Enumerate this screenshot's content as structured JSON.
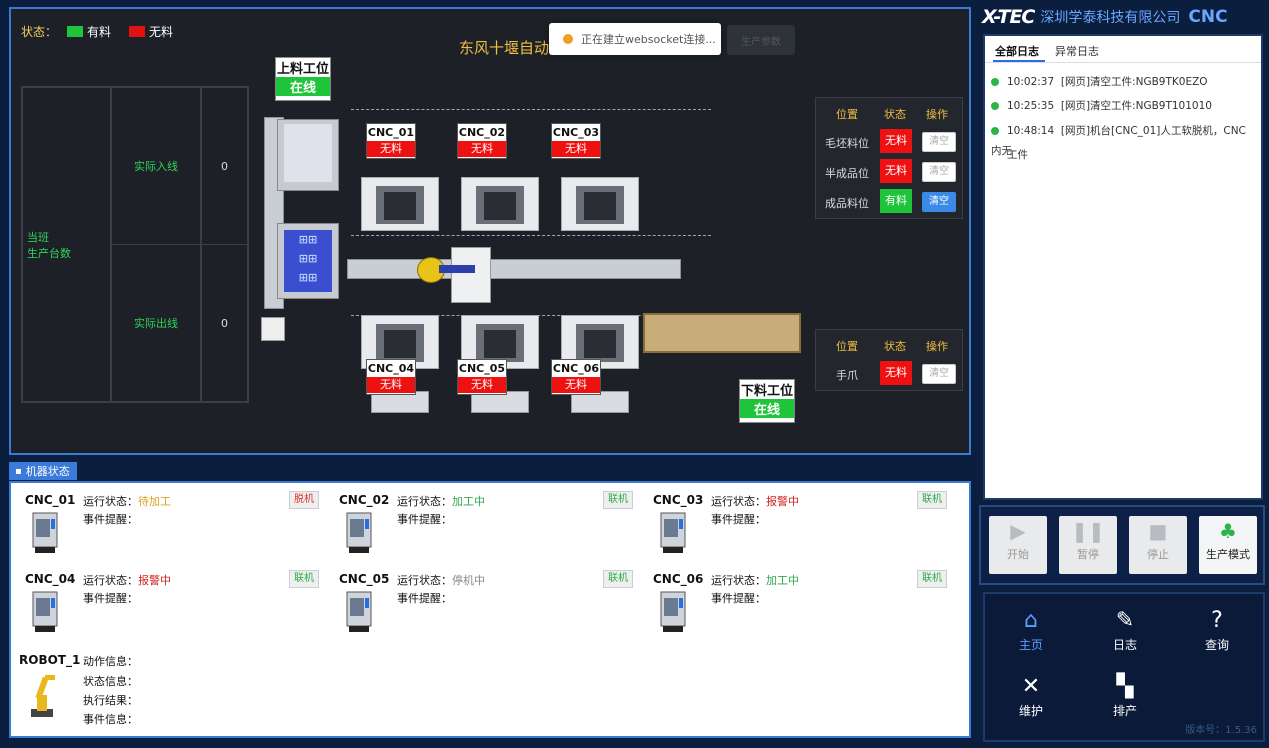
{
  "header": {
    "brand_logo": "X-TEC",
    "company": "深圳学泰科技有限公司",
    "product": "CNC",
    "accent_color": "#3c7ad9"
  },
  "legend": {
    "label": "状态：",
    "has_material": "有料",
    "has_material_color": "#1ec43a",
    "no_material": "无料",
    "no_material_color": "#e11111"
  },
  "line_title": "东风十堰自动",
  "toast": {
    "text": "正在建立websocket连接...",
    "ghost_button": "生产参数"
  },
  "production": {
    "group_label_1": "当班",
    "group_label_2": "生产台数",
    "in_label": "实际入线",
    "in_value": "0",
    "out_label": "实际出线",
    "out_value": "0"
  },
  "stations": {
    "load_title": "上料工位",
    "load_state": "在线",
    "unload_title": "下料工位",
    "unload_state": "在线"
  },
  "cnc_labels": [
    {
      "name": "CNC_01",
      "state": "无料"
    },
    {
      "name": "CNC_02",
      "state": "无料"
    },
    {
      "name": "CNC_03",
      "state": "无料"
    },
    {
      "name": "CNC_04",
      "state": "无料"
    },
    {
      "name": "CNC_05",
      "state": "无料"
    },
    {
      "name": "CNC_06",
      "state": "无料"
    }
  ],
  "material_table": {
    "headers": [
      "位置",
      "状态",
      "操作"
    ],
    "rows": [
      {
        "position": "毛坯料位",
        "state": "无料",
        "action": "清空",
        "active": false
      },
      {
        "position": "半成品位",
        "state": "无料",
        "action": "清空",
        "active": false
      },
      {
        "position": "成品料位",
        "state": "有料",
        "action": "清空",
        "active": true
      }
    ]
  },
  "gripper_table": {
    "headers": [
      "位置",
      "状态",
      "操作"
    ],
    "rows": [
      {
        "position": "手爪",
        "state": "无料",
        "action": "清空"
      }
    ]
  },
  "machine_status": {
    "tab": "机器状态",
    "run_label": "运行状态：",
    "event_label": "事件提醒：",
    "machines": [
      {
        "name": "CNC_01",
        "state": "待加工",
        "state_color": "#e0a020",
        "link": "脱机",
        "link_color": "#e03030"
      },
      {
        "name": "CNC_02",
        "state": "加工中",
        "state_color": "#2fa84a",
        "link": "联机",
        "link_color": "#2fa84a"
      },
      {
        "name": "CNC_03",
        "state": "报警中",
        "state_color": "#d02020",
        "link": "联机",
        "link_color": "#2fa84a"
      },
      {
        "name": "CNC_04",
        "state": "报警中",
        "state_color": "#d02020",
        "link": "联机",
        "link_color": "#2fa84a"
      },
      {
        "name": "CNC_05",
        "state": "停机中",
        "state_color": "#888888",
        "link": "联机",
        "link_color": "#2fa84a"
      },
      {
        "name": "CNC_06",
        "state": "加工中",
        "state_color": "#2fa84a",
        "link": "联机",
        "link_color": "#2fa84a"
      }
    ],
    "robot": {
      "name": "ROBOT_1",
      "action_label": "动作信息：",
      "status_label": "状态信息：",
      "result_label": "执行结果：",
      "event_label": "事件信息："
    }
  },
  "logs": {
    "tabs": [
      "全部日志",
      "异常日志"
    ],
    "entries": [
      {
        "time": "10:02:37",
        "text": "[网页]清空工件:NGB9TK0EZO"
      },
      {
        "time": "10:25:35",
        "text": "[网页]清空工件:NGB9T101010"
      },
      {
        "time": "10:48:14",
        "text": "[网页]机台[CNC_01]人工软脱机，CNC内无",
        "cont": "工件"
      }
    ]
  },
  "controls": [
    {
      "label": "开始",
      "icon": "play-icon"
    },
    {
      "label": "暂停",
      "icon": "pause-icon"
    },
    {
      "label": "停止",
      "icon": "stop-icon"
    },
    {
      "label": "生产模式",
      "icon": "broom-icon"
    }
  ],
  "nav": [
    {
      "label": "主页",
      "icon": "home-icon"
    },
    {
      "label": "日志",
      "icon": "log-icon"
    },
    {
      "label": "查询",
      "icon": "query-icon"
    },
    {
      "label": "维护",
      "icon": "tools-icon"
    },
    {
      "label": "排产",
      "icon": "schedule-icon"
    }
  ],
  "version": "版本号：1.5.36"
}
